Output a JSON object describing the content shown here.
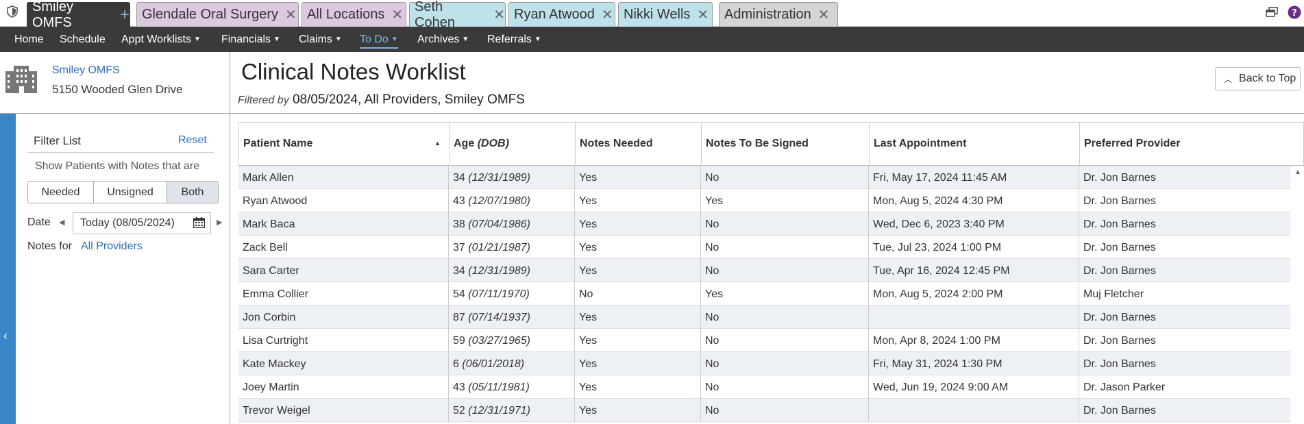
{
  "tabs": [
    {
      "label": "Smiley OMFS",
      "style": "active"
    },
    {
      "label": "Glendale Oral Surgery",
      "style": "pink"
    },
    {
      "label": "All Locations",
      "style": "pink"
    },
    {
      "label": "Seth Cohen",
      "style": "cyan"
    },
    {
      "label": "Ryan Atwood",
      "style": "cyan"
    },
    {
      "label": "Nikki Wells",
      "style": "cyan"
    },
    {
      "label": "Administration",
      "style": "gray"
    }
  ],
  "menu": [
    {
      "label": "Home",
      "dropdown": false
    },
    {
      "label": "Schedule",
      "dropdown": false
    },
    {
      "label": "Appt Worklists",
      "dropdown": true
    },
    {
      "label": "Financials",
      "dropdown": true
    },
    {
      "label": "Claims",
      "dropdown": true
    },
    {
      "label": "To Do",
      "dropdown": true,
      "active": true
    },
    {
      "label": "Archives",
      "dropdown": true
    },
    {
      "label": "Referrals",
      "dropdown": true
    }
  ],
  "practice": {
    "name": "Smiley OMFS",
    "address": "5150 Wooded Glen Drive"
  },
  "filter": {
    "title": "Filter List",
    "reset": "Reset",
    "show_label": "Show Patients with Notes that are",
    "options": [
      "Needed",
      "Unsigned",
      "Both"
    ],
    "selected": "Both",
    "date_label": "Date",
    "date_value": "Today (08/05/2024)",
    "notes_for_label": "Notes for",
    "notes_for_value": "All Providers"
  },
  "main": {
    "title": "Clinical Notes Worklist",
    "filtered_label": "Filtered by",
    "filtered_value": "08/05/2024, All Providers, Smiley OMFS",
    "back_to_top": "Back to Top"
  },
  "table": {
    "columns": [
      "Patient Name",
      "Age",
      "(DOB)",
      "Notes Needed",
      "Notes To Be Signed",
      "Last Appointment",
      "Preferred Provider"
    ],
    "rows": [
      {
        "name": "Mark Allen",
        "age": "34",
        "dob": "(12/31/1989)",
        "needed": "Yes",
        "to_sign": "No",
        "last_appt": "Fri, May 17, 2024 11:45 AM",
        "provider": "Dr. Jon Barnes"
      },
      {
        "name": "Ryan Atwood",
        "age": "43",
        "dob": "(12/07/1980)",
        "needed": "Yes",
        "to_sign": "Yes",
        "last_appt": "Mon, Aug 5, 2024 4:30 PM",
        "provider": "Dr. Jon Barnes"
      },
      {
        "name": "Mark Baca",
        "age": "38",
        "dob": "(07/04/1986)",
        "needed": "Yes",
        "to_sign": "No",
        "last_appt": "Wed, Dec 6, 2023 3:40 PM",
        "provider": "Dr. Jon Barnes"
      },
      {
        "name": "Zack Bell",
        "age": "37",
        "dob": "(01/21/1987)",
        "needed": "Yes",
        "to_sign": "No",
        "last_appt": "Tue, Jul 23, 2024 1:00 PM",
        "provider": "Dr. Jon Barnes"
      },
      {
        "name": "Sara Carter",
        "age": "34",
        "dob": "(12/31/1989)",
        "needed": "Yes",
        "to_sign": "No",
        "last_appt": "Tue, Apr 16, 2024 12:45 PM",
        "provider": "Dr. Jon Barnes"
      },
      {
        "name": "Emma Collier",
        "age": "54",
        "dob": "(07/11/1970)",
        "needed": "No",
        "to_sign": "Yes",
        "last_appt": "Mon, Aug 5, 2024 2:00 PM",
        "provider": "Muj Fletcher"
      },
      {
        "name": "Jon Corbin",
        "age": "87",
        "dob": "(07/14/1937)",
        "needed": "Yes",
        "to_sign": "No",
        "last_appt": "",
        "provider": "Dr. Jon Barnes"
      },
      {
        "name": "Lisa Curtright",
        "age": "59",
        "dob": "(03/27/1965)",
        "needed": "Yes",
        "to_sign": "No",
        "last_appt": "Mon, Apr 8, 2024 1:00 PM",
        "provider": "Dr. Jon Barnes"
      },
      {
        "name": "Kate Mackey",
        "age": "6",
        "dob": "(06/01/2018)",
        "needed": "Yes",
        "to_sign": "No",
        "last_appt": "Fri, May 31, 2024 1:30 PM",
        "provider": "Dr. Jon Barnes"
      },
      {
        "name": "Joey Martin",
        "age": "43",
        "dob": "(05/11/1981)",
        "needed": "Yes",
        "to_sign": "No",
        "last_appt": "Wed, Jun 19, 2024 9:00 AM",
        "provider": "Dr. Jason Parker"
      },
      {
        "name": "Trevor Weigel",
        "age": "52",
        "dob": "(12/31/1971)",
        "needed": "Yes",
        "to_sign": "No",
        "last_appt": "",
        "provider": "Dr. Jon Barnes"
      }
    ]
  },
  "colors": {
    "tab_active": "#3a3a3a",
    "tab_pink": "#dcc9e0",
    "tab_cyan": "#bfe1ea",
    "tab_gray": "#d4d4d4",
    "link": "#2a6ebb",
    "menu_active": "#7fb2e5",
    "collapse_bar": "#3a86c8",
    "row_alt": "#edf0f4"
  },
  "icons": [
    "shield-icon",
    "window-restore-icon",
    "help-icon",
    "building-icon",
    "calendar-icon",
    "chevron-left-icon",
    "sort-asc-icon"
  ]
}
